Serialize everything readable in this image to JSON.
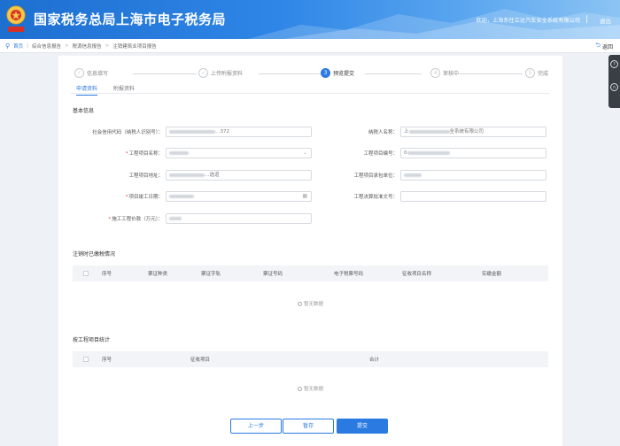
{
  "header": {
    "site_title": "国家税务总局上海市电子税务局",
    "welcome": "欢迎，上海东任立达汽车安全系统有限公司",
    "logout": "退出"
  },
  "breadcrumb": {
    "home": "首页",
    "items": [
      "综合信息报告",
      "税源信息报告",
      "注销建筑业项目报告"
    ],
    "back": "返回"
  },
  "stepper": {
    "steps": [
      {
        "icon": "✓",
        "label": "信息填写"
      },
      {
        "icon": "✓",
        "label": "上传附报资料"
      },
      {
        "icon": "3",
        "label": "预览提交"
      },
      {
        "icon": "4",
        "label": "审核中"
      },
      {
        "icon": "5",
        "label": "完成"
      }
    ],
    "active_index": 2
  },
  "tabs": [
    "申请资料",
    "附报资料"
  ],
  "basic_info": {
    "title": "基本信息",
    "fields": {
      "credit_code": {
        "label": "社会信用代码（纳税人识别号）：",
        "value": "…372"
      },
      "taxpayer_name": {
        "label": "纳税人名称：",
        "prefix": "上",
        "suffix": "全系统有限公司"
      },
      "project_name": {
        "label": "工程项目名称：",
        "value": ""
      },
      "project_no": {
        "label": "工程项目编号：",
        "value": "0"
      },
      "project_address": {
        "label": "工程项目地址：",
        "value": "…选道"
      },
      "contract_parties": {
        "label": "工程项目承包单位：",
        "value": ""
      },
      "completion_date": {
        "label": "项目竣工日期：",
        "value": ""
      },
      "settlement_doc": {
        "label": "工程决算批准文号：",
        "value": ""
      },
      "construction_price": {
        "label": "施工工程价款（万元）：",
        "value": ""
      }
    }
  },
  "invoice_table": {
    "title": "注销时已缴税情况",
    "columns": [
      "序号",
      "票证种类",
      "票证字轨",
      "票证号码",
      "电子税票号码",
      "征收项目名称",
      "实缴金额"
    ],
    "empty_text": "暂无数据"
  },
  "project_table": {
    "title": "按工程项目统计",
    "columns": [
      "序号",
      "征收项目",
      "合计"
    ],
    "empty_text": "暂无数据"
  },
  "buttons": {
    "prev": "上一步",
    "save": "暂存",
    "submit": "提交"
  },
  "colors": {
    "accent": "#2a7ae2",
    "required": "#e2403a"
  }
}
